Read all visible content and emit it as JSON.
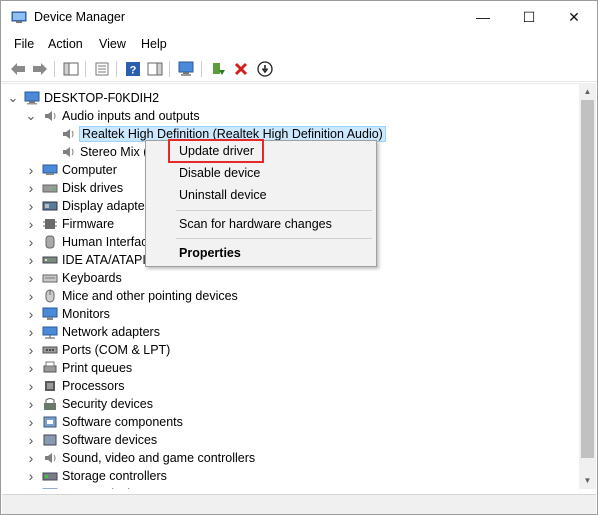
{
  "window": {
    "title": "Device Manager",
    "minimize_glyph": "—",
    "maximize_glyph": "☐",
    "close_glyph": "✕"
  },
  "menu": [
    "File",
    "Action",
    "View",
    "Help"
  ],
  "toolbar": {
    "buttons": [
      "back-arrow-icon",
      "forward-arrow-icon",
      "show-hide-console-tree-icon",
      "properties-icon",
      "help-icon",
      "action-pane-icon",
      "scan-hardware-icon",
      "update-driver-icon",
      "uninstall-device-icon",
      "disable-device-icon"
    ]
  },
  "tree": {
    "root": "DESKTOP-F0KDIH2",
    "categories": [
      {
        "label": "Audio inputs and outputs",
        "expanded": true,
        "icon": "speaker-icon"
      },
      {
        "label": "Computer",
        "icon": "computer-icon"
      },
      {
        "label": "Disk drives",
        "icon": "disk-drive-icon"
      },
      {
        "label": "Display adapters",
        "icon": "display-adapter-icon"
      },
      {
        "label": "Firmware",
        "icon": "firmware-icon"
      },
      {
        "label": "Human Interface Devices",
        "icon": "hid-icon"
      },
      {
        "label": "IDE ATA/ATAPI controllers",
        "icon": "ide-controller-icon"
      },
      {
        "label": "Keyboards",
        "icon": "keyboard-icon"
      },
      {
        "label": "Mice and other pointing devices",
        "icon": "mouse-icon"
      },
      {
        "label": "Monitors",
        "icon": "monitor-icon"
      },
      {
        "label": "Network adapters",
        "icon": "network-adapter-icon"
      },
      {
        "label": "Ports (COM & LPT)",
        "icon": "port-icon"
      },
      {
        "label": "Print queues",
        "icon": "printer-icon"
      },
      {
        "label": "Processors",
        "icon": "processor-icon"
      },
      {
        "label": "Security devices",
        "icon": "security-device-icon"
      },
      {
        "label": "Software components",
        "icon": "software-component-icon"
      },
      {
        "label": "Software devices",
        "icon": "software-device-icon"
      },
      {
        "label": "Sound, video and game controllers",
        "icon": "sound-controller-icon"
      },
      {
        "label": "Storage controllers",
        "icon": "storage-controller-icon"
      },
      {
        "label": "System devices",
        "icon": "system-device-icon"
      }
    ],
    "audio_children": [
      "Realtek High Definition (Realtek High Definition Audio)",
      "Stereo Mix (Realtek High Definition Audio)"
    ]
  },
  "context_menu": {
    "items": [
      "Update driver",
      "Disable device",
      "Uninstall device",
      "Scan for hardware changes",
      "Properties"
    ],
    "highlighted": "Update driver"
  },
  "colors": {
    "selection": "#cce8ff",
    "highlight_border": "#e32a2a"
  }
}
